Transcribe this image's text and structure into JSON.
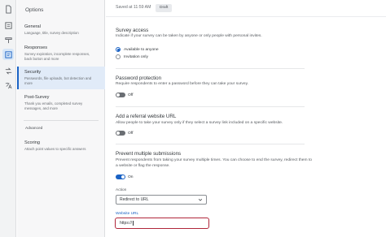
{
  "rail": {
    "icons": [
      "document-icon",
      "list-icon",
      "brush-icon",
      "survey-options-icon",
      "workflow-icon",
      "translate-icon"
    ]
  },
  "panel": {
    "title": "Options",
    "items": [
      {
        "label": "General",
        "desc": "Language, title, survey description"
      },
      {
        "label": "Responses",
        "desc": "Survey expiration, incomplete responses, back button and more"
      },
      {
        "label": "Security",
        "desc": "Passwords, file uploads, bot detection and more"
      },
      {
        "label": "Post-Survey",
        "desc": "Thank you emails, completed survey messages, and more"
      }
    ],
    "advanced_label": "Advanced",
    "advanced_items": [
      {
        "label": "Scoring",
        "desc": "Attach point values to specific answers"
      }
    ]
  },
  "topbar": {
    "save_status": "Saved at 11:59 AM",
    "badge": "Draft"
  },
  "survey_access": {
    "title": "Survey access",
    "desc": "Indicate if your survey can be taken by anyone or only people with personal invites.",
    "options": [
      "Available to anyone",
      "Invitation only"
    ],
    "selected": "Available to anyone"
  },
  "password_protection": {
    "title": "Password protection",
    "desc": "Require respondents to enter a password before they can take your survey.",
    "toggle_label": "Off"
  },
  "referral": {
    "title": "Add a referral website URL",
    "desc": "Allow people to take your survey only if they select a survey link included on a specific website.",
    "toggle_label": "Off"
  },
  "prevent_multiple": {
    "title": "Prevent multiple submissions",
    "desc_line1": "Prevent respondents from taking your survey multiple times. You can choose to end the survey, redirect them to",
    "desc_line2": "a website or flag the response.",
    "toggle_label": "On",
    "action_label": "Action",
    "action_value": "Redirect to URL",
    "url_label": "Website URL",
    "url_value": "https://"
  },
  "colors": {
    "accent": "#1a62c4",
    "error_border": "#b0263a"
  }
}
